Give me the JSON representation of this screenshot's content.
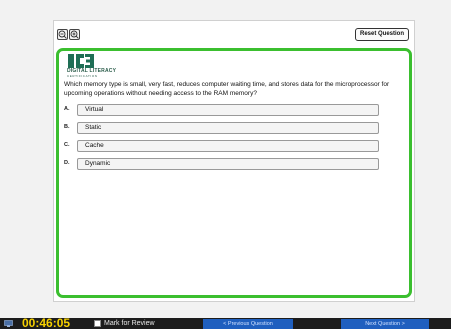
{
  "toolbar": {
    "zoom_out_icon": "zoom-out-icon",
    "zoom_in_icon": "zoom-in-icon",
    "reset_label": "Reset Question"
  },
  "logo": {
    "mark": "IC3",
    "line1": "DIGITAL LITERACY",
    "line2": "CERTIFICATION",
    "color": "#1f6e55"
  },
  "question": {
    "text": "Which memory type is small, very fast, reduces computer waiting time, and stores data for the microprocessor for upcoming operations without needing access to the RAM memory?",
    "options": [
      {
        "letter": "A.",
        "label": "Virtual"
      },
      {
        "letter": "B.",
        "label": "Static"
      },
      {
        "letter": "C.",
        "label": "Cache"
      },
      {
        "letter": "D.",
        "label": "Dynamic"
      }
    ]
  },
  "bottom_bar": {
    "timer": "00:46:05",
    "mark_for_review": "Mark for Review",
    "previous": "< Previous Question",
    "next": "Next Question >"
  },
  "colors": {
    "frame_border": "#3bbf2f",
    "timer": "#f5d000",
    "nav_button": "#1f5fbf"
  }
}
